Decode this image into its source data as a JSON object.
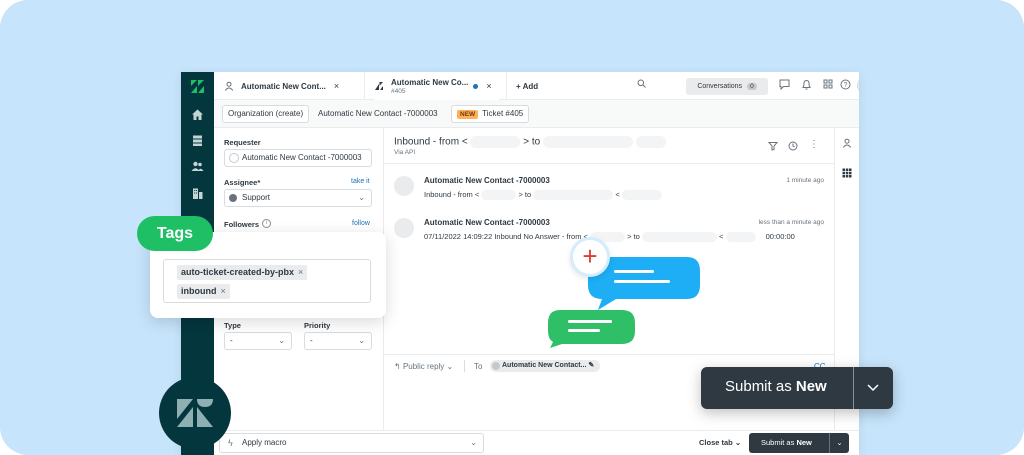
{
  "tabs": [
    {
      "title": "Automatic New Cont...",
      "subtitle": ""
    },
    {
      "title": "Automatic New Co...",
      "subtitle": "#405"
    }
  ],
  "add_tab_label": "+ Add",
  "conversations": {
    "label": "Conversations",
    "count": "0"
  },
  "breadcrumbs": {
    "organization": "Organization (create)",
    "contact": "Automatic New Contact -7000003",
    "badge": "NEW",
    "ticket": "Ticket #405"
  },
  "sidebar": {
    "requester_label": "Requester",
    "requester_value": "Automatic New Contact -7000003",
    "assignee_label": "Assignee*",
    "take_it": "take it",
    "assignee_value": "Support",
    "followers_label": "Followers",
    "follow_link": "follow",
    "type_label": "Type",
    "type_value": "-",
    "priority_label": "Priority",
    "priority_value": "-"
  },
  "ticket": {
    "subject_prefix": "Inbound - from <",
    "subject_to": "> to",
    "via": "Via API"
  },
  "messages": [
    {
      "author": "Automatic New Contact -7000003",
      "time": "1 minute ago",
      "body_a": "Inbound - from <",
      "body_b": "> to",
      "body_c": "<"
    },
    {
      "author": "Automatic New Contact -7000003",
      "time": "less than a minute ago",
      "body_a": "07/11/2022 14:09:22 Inbound No Answer - from <",
      "body_b": "> to",
      "body_c": "<",
      "duration": "00:00:00"
    }
  ],
  "reply": {
    "mode": "Public reply",
    "to_label": "To",
    "recipient": "Automatic New Contact...",
    "cc": "CC"
  },
  "bottom": {
    "macro": "Apply macro",
    "close_tab": "Close tab",
    "submit_prefix": "Submit as",
    "submit_status": "New"
  },
  "callout": {
    "title": "Tags",
    "tags": [
      "auto-ticket-created-by-pbx",
      "inbound"
    ]
  },
  "big_submit": {
    "prefix": "Submit as",
    "status": "New"
  },
  "colors": {
    "rail": "#03363d",
    "accent_green": "#1fbf66",
    "bubble_blue": "#1daef5",
    "bubble_green": "#2fbf66",
    "submit": "#2f3941"
  }
}
